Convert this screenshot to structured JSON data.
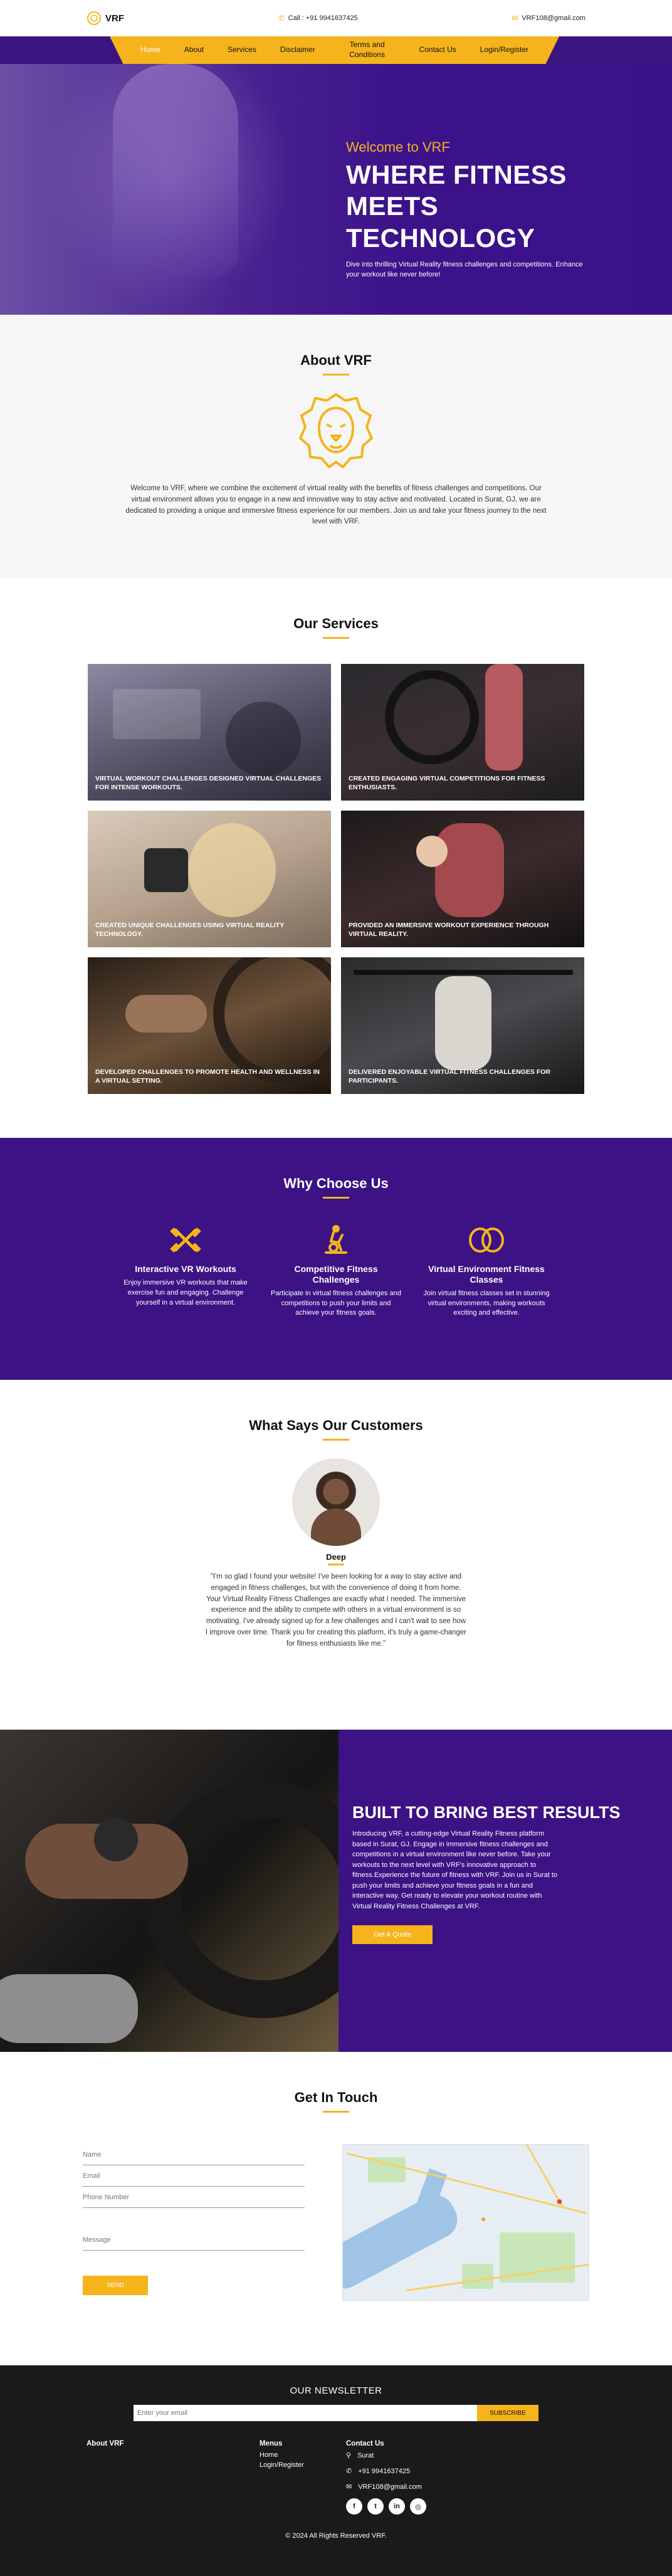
{
  "brand": {
    "name": "VRF"
  },
  "topbar": {
    "phone": "Call : +91 9941637425",
    "email": "VRF108@gmail.com"
  },
  "nav": {
    "items": [
      {
        "label": "Home"
      },
      {
        "label": "About"
      },
      {
        "label": "Services"
      },
      {
        "label": "Disclaimer"
      },
      {
        "label": "Terms and Conditions"
      },
      {
        "label": "Contact Us"
      },
      {
        "label": "Login/Register"
      }
    ]
  },
  "hero": {
    "welcome": "Welcome to VRF",
    "title": "WHERE FITNESS MEETS TECHNOLOGY",
    "subtitle": "Dive into thrilling Virtual Reality fitness challenges and competitions. Enhance your workout like never before!"
  },
  "about": {
    "title": "About VRF",
    "text": "Welcome to VRF, where we combine the excitement of virtual reality with the benefits of fitness challenges and competitions. Our virtual environment allows you to engage in a new and innovative way to stay active and motivated. Located in Surat, GJ, we are dedicated to providing a unique and immersive fitness experience for our members. Join us and take your fitness journey to the next level with VRF."
  },
  "services": {
    "title": "Our Services",
    "items": [
      {
        "caption": "VIRTUAL WORKOUT CHALLENGES DESIGNED VIRTUAL CHALLENGES FOR INTENSE WORKOUTS."
      },
      {
        "caption": "CREATED ENGAGING VIRTUAL COMPETITIONS FOR FITNESS ENTHUSIASTS."
      },
      {
        "caption": "CREATED UNIQUE CHALLENGES USING VIRTUAL REALITY TECHNOLOGY."
      },
      {
        "caption": "PROVIDED AN IMMERSIVE WORKOUT EXPERIENCE THROUGH VIRTUAL REALITY."
      },
      {
        "caption": "DEVELOPED CHALLENGES TO PROMOTE HEALTH AND WELLNESS IN A VIRTUAL SETTING."
      },
      {
        "caption": "DELIVERED ENJOYABLE VIRTUAL FITNESS CHALLENGES FOR PARTICIPANTS."
      }
    ]
  },
  "why": {
    "title": "Why Choose Us",
    "items": [
      {
        "title": "Interactive VR Workouts",
        "text": "Enjoy immersive VR workouts that make exercise fun and engaging. Challenge yourself in a virtual environment.",
        "icon": "dumbbells-icon"
      },
      {
        "title": "Competitive Fitness Challenges",
        "text": "Participate in virtual fitness challenges and competitions to push your limits and achieve your fitness goals.",
        "icon": "stationary-bike-icon"
      },
      {
        "title": "Virtual Environment Fitness Classes",
        "text": "Join virtual fitness classes set in stunning virtual environments, making workouts exciting and effective.",
        "icon": "vr-headset-icon"
      }
    ]
  },
  "customers": {
    "title": "What Says Our Customers",
    "name": "Deep",
    "quote": "\"I'm so glad I found your website! I've been looking for a way to stay active and engaged in fitness challenges, but with the convenience of doing it from home. Your Virtual Reality Fitness Challenges are exactly what I needed. The immersive experience and the ability to compete with others in a virtual environment is so motivating. I've already signed up for a few challenges and I can't wait to see how I improve over time. Thank you for creating this platform, it's truly a game-changer for fitness enthusiasts like me.\""
  },
  "results": {
    "title": "BUILT TO BRING BEST RESULTS",
    "text": "Introducing VRF, a cutting-edge Virtual Reality Fitness platform based in Surat, GJ. Engage in immersive fitness challenges and competitions in a virtual environment like never before. Take your workouts to the next level with VRF's innovative approach to fitness.Experience the future of fitness with VRF. Join us in Surat to push your limits and achieve your fitness goals in a fun and interactive way. Get ready to elevate your workout routine with Virtual Reality Fitness Challenges at VRF.",
    "button": "Get A Quote"
  },
  "contact": {
    "title": "Get In Touch",
    "name_placeholder": "Name",
    "email_placeholder": "Email",
    "phone_placeholder": "Phone Number",
    "message_placeholder": "Message",
    "send": "SEND"
  },
  "footer": {
    "newsletter_title": "OUR NEWSLETTER",
    "newsletter_placeholder": "Enter your email",
    "subscribe": "SUBSCRIBE",
    "about_heading": "About VRF",
    "menus_heading": "Menus",
    "menus": [
      "Home",
      "Login/Register"
    ],
    "contact_heading": "Contact Us",
    "city": "Surat",
    "phone": "+91 9941637425",
    "email": "VRF108@gmail.com",
    "socials": [
      {
        "icon": "facebook-icon",
        "glyph": "f"
      },
      {
        "icon": "twitter-icon",
        "glyph": "t"
      },
      {
        "icon": "linkedin-icon",
        "glyph": "in"
      },
      {
        "icon": "instagram-icon",
        "glyph": "◎"
      }
    ],
    "copyright": "© 2024 All Rights Reserved VRF."
  },
  "colors": {
    "accent": "#f5b41c",
    "purple": "#3c1285",
    "footer": "#1a1a1a"
  }
}
